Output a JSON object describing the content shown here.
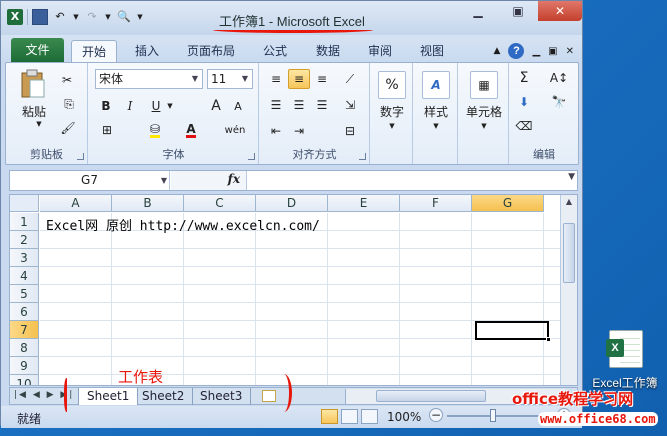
{
  "window": {
    "title": "工作簿1 - Microsoft Excel",
    "qat_excel_glyph": "X"
  },
  "tabs": [
    {
      "label": "文件",
      "type": "file"
    },
    {
      "label": "开始",
      "active": true
    },
    {
      "label": "插入"
    },
    {
      "label": "页面布局"
    },
    {
      "label": "公式"
    },
    {
      "label": "数据"
    },
    {
      "label": "审阅"
    },
    {
      "label": "视图"
    }
  ],
  "help_glyph": "?",
  "ribbon": {
    "clipboard": {
      "label": "剪贴板",
      "paste": "粘贴"
    },
    "font": {
      "label": "字体",
      "name": "宋体",
      "size": "11",
      "bold": "B",
      "italic": "I",
      "underline": "U",
      "grow": "A",
      "shrink": "A",
      "font_color": "A",
      "phonetic": "wén"
    },
    "alignment": {
      "label": "对齐方式"
    },
    "number": {
      "label": "数字",
      "format_glyph": "%"
    },
    "styles": {
      "label": "样式"
    },
    "cells": {
      "label": "单元格"
    },
    "editing": {
      "label": "编辑",
      "sum_glyph": "Σ"
    }
  },
  "formula_bar": {
    "name_box": "G7",
    "fx": "fx",
    "content": ""
  },
  "columns": [
    "A",
    "B",
    "C",
    "D",
    "E",
    "F",
    "G"
  ],
  "selected_column": "G",
  "rows": [
    "1",
    "2",
    "3",
    "4",
    "5",
    "6",
    "7",
    "8",
    "9",
    "10"
  ],
  "selected_row": "7",
  "cell_a1": "Excel网 原创 http://www.excelcn.com/",
  "sheets": [
    "Sheet1",
    "Sheet2",
    "Sheet3"
  ],
  "active_sheet": "Sheet1",
  "status": {
    "ready": "就绪",
    "zoom": "100%",
    "zoom_minus": "−",
    "zoom_plus": "+"
  },
  "annotations": {
    "sheet_label": "工作表"
  },
  "desktop": {
    "icon_label": "Excel工作簿",
    "badge": "X"
  },
  "watermark": {
    "text": "office教程学习网",
    "url": "www.office68.com"
  },
  "colors": {
    "file_tab": "#1d6b36",
    "selection_header": "#f5c04f",
    "annotation": "#e8170c"
  }
}
